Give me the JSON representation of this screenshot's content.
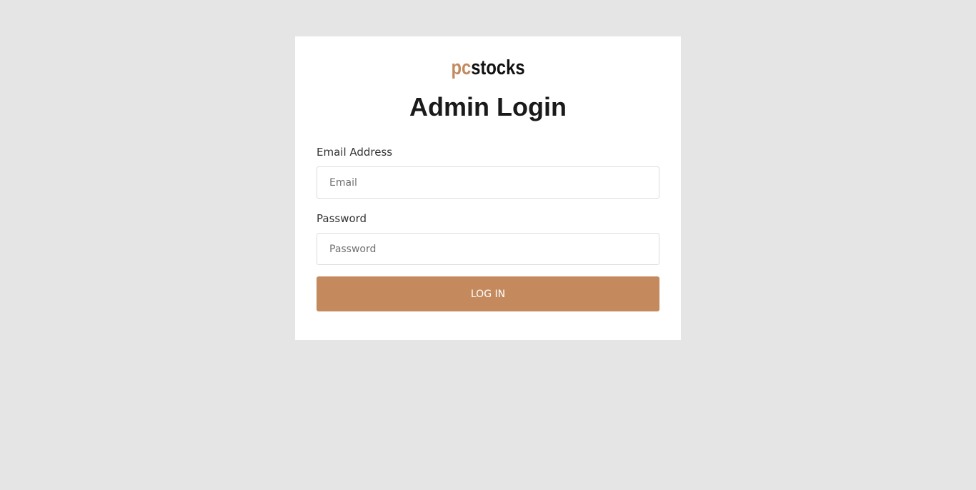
{
  "brand": {
    "logo_accent": "pc",
    "logo_main": "stocks",
    "accent_color": "#c48a5e"
  },
  "login": {
    "title": "Admin Login",
    "email_label": "Email Address",
    "email_placeholder": "Email",
    "email_value": "",
    "password_label": "Password",
    "password_placeholder": "Password",
    "password_value": "",
    "submit_label": "LOG IN"
  }
}
